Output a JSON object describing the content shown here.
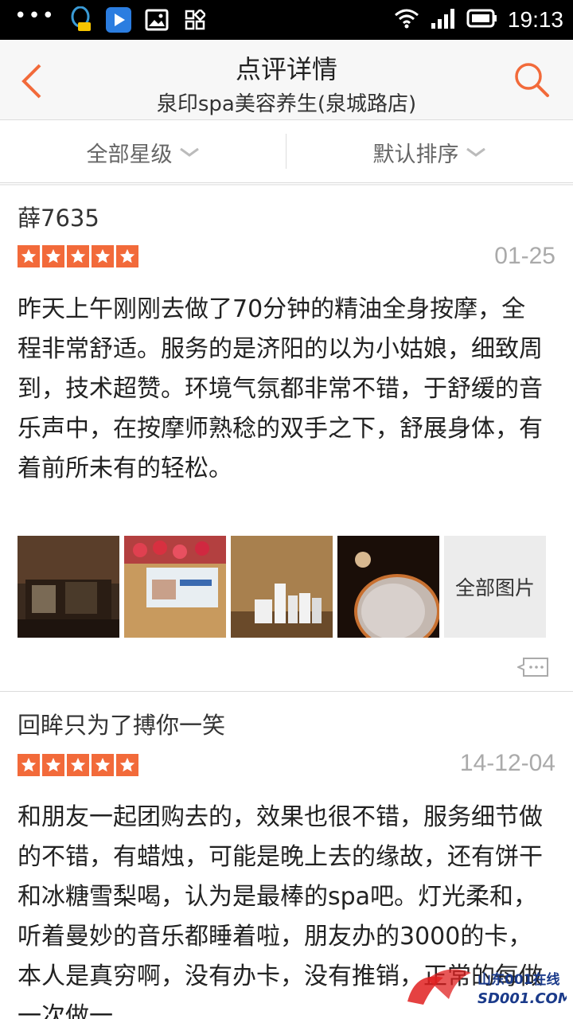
{
  "status_bar": {
    "dots": "•••",
    "time": "19:13",
    "icons": [
      "qq-icon",
      "video-player-icon",
      "gallery-icon",
      "apps-grid-icon",
      "wifi-icon",
      "signal-icon",
      "battery-icon"
    ]
  },
  "header": {
    "title": "点评详情",
    "subtitle": "泉印spa美容养生(泉城路店)",
    "back_icon": "back-chevron-icon",
    "search_icon": "search-icon"
  },
  "filters": {
    "rating": "全部星级",
    "sort": "默认排序"
  },
  "reviews": [
    {
      "username": "薛7635",
      "rating": 5,
      "date": "01-25",
      "content": "昨天上午刚刚去做了70分钟的精油全身按摩，全程非常舒适。服务的是济阳的以为小姑娘，细致周到，技术超赞。环境气氛都非常不错，于舒缓的音乐声中，在按摩师熟稔的双手之下，舒展身体，有着前所未有的轻松。",
      "all_photos_label": "全部图片"
    },
    {
      "username": "回眸只为了搏你一笑",
      "rating": 5,
      "date": "14-12-04",
      "content": "和朋友一起团购去的，效果也很不错，服务细节做的不错，有蜡烛，可能是晚上去的缘故，还有饼干和冰糖雪梨喝，认为是最棒的spa吧。灯光柔和，听着曼妙的音乐都睡着啦，朋友办的3000的卡，本人是真穷啊，没有办卡，没有推销，正常的每做一次做一"
    }
  ],
  "watermark": {
    "line1": "山东001在线",
    "line2": "SD001.COM"
  },
  "colors": {
    "accent": "#f26a3a",
    "star": "#f26a3a",
    "date_gray": "#aaaaaa"
  }
}
